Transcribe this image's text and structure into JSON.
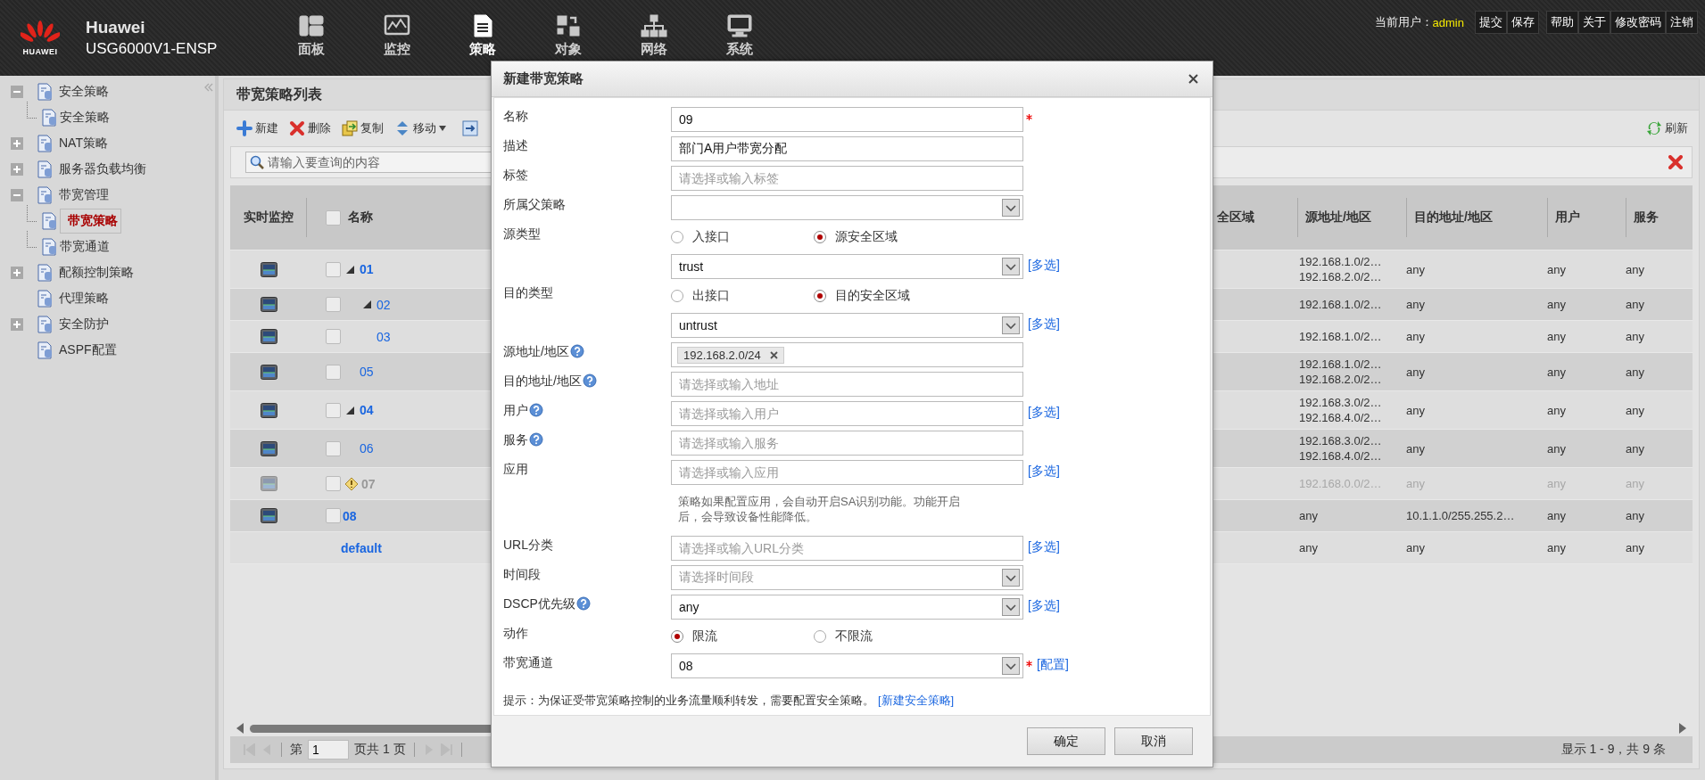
{
  "header": {
    "logo_text": "HUAWEI",
    "brand": "Huawei",
    "model": "USG6000V1-ENSP",
    "nav": [
      {
        "label": "面板",
        "selected": false
      },
      {
        "label": "监控",
        "selected": false
      },
      {
        "label": "策略",
        "selected": true
      },
      {
        "label": "对象",
        "selected": false
      },
      {
        "label": "网络",
        "selected": false
      },
      {
        "label": "系统",
        "selected": false
      }
    ],
    "user_label": "当前用户：",
    "user": "admin",
    "link_groups": [
      [
        "提交",
        "保存"
      ],
      [
        "帮助",
        "关于",
        "修改密码",
        "注销"
      ]
    ]
  },
  "sidebar": {
    "items": [
      {
        "label": "安全策略",
        "kind": "group",
        "expanded": true,
        "selected": false,
        "children": [
          {
            "label": "安全策略",
            "selected": false
          }
        ]
      },
      {
        "label": "NAT策略",
        "kind": "group",
        "expanded": false,
        "selected": false
      },
      {
        "label": "服务器负载均衡",
        "kind": "group",
        "expanded": false,
        "selected": false
      },
      {
        "label": "带宽管理",
        "kind": "group",
        "expanded": true,
        "selected": false,
        "children": [
          {
            "label": "带宽策略",
            "selected": true
          },
          {
            "label": "带宽通道",
            "selected": false
          }
        ]
      },
      {
        "label": "配额控制策略",
        "kind": "group",
        "expanded": false,
        "selected": false
      },
      {
        "label": "代理策略",
        "kind": "leaf",
        "selected": false
      },
      {
        "label": "安全防护",
        "kind": "group",
        "expanded": false,
        "selected": false
      },
      {
        "label": "ASPF配置",
        "kind": "leaf",
        "selected": false
      }
    ]
  },
  "panel": {
    "title": "带宽策略列表",
    "toolbar": [
      {
        "label": "新建",
        "menu": false
      },
      {
        "label": "删除",
        "menu": false
      },
      {
        "label": "复制",
        "menu": false
      },
      {
        "label": "移动",
        "menu": true
      }
    ],
    "refresh": "刷新",
    "search": {
      "placeholder": "请输入要查询的内容"
    }
  },
  "table": {
    "select_all": {
      "checked": false
    },
    "columns": [
      "实时监控",
      "名称",
      "全区域",
      "源地址/地区",
      "目的地址/地区",
      "用户",
      "服务"
    ],
    "rows": [
      {
        "kind": "policy",
        "name": "01",
        "bold": true,
        "disabled": false,
        "checked": false,
        "expanded": true,
        "src": [
          "192.168.1.0/2…",
          "192.168.2.0/2…"
        ],
        "dst": "any",
        "user": "any",
        "service": "any",
        "children": [
          {
            "kind": "policy",
            "name": "02",
            "bold": false,
            "disabled": false,
            "checked": false,
            "expanded": true,
            "src": [
              "192.168.1.0/2…"
            ],
            "dst": "any",
            "user": "any",
            "service": "any",
            "children": [
              {
                "kind": "policy",
                "name": "03",
                "bold": false,
                "disabled": false,
                "checked": false,
                "src": [
                  "192.168.1.0/2…"
                ],
                "dst": "any",
                "user": "any",
                "service": "any"
              }
            ]
          },
          {
            "kind": "policy",
            "name": "05",
            "bold": false,
            "disabled": false,
            "checked": false,
            "src": [
              "192.168.1.0/2…",
              "192.168.2.0/2…"
            ],
            "dst": "any",
            "user": "any",
            "service": "any"
          }
        ]
      },
      {
        "kind": "policy",
        "name": "04",
        "bold": true,
        "disabled": false,
        "checked": false,
        "expanded": true,
        "src": [
          "192.168.3.0/2…",
          "192.168.4.0/2…"
        ],
        "dst": "any",
        "user": "any",
        "service": "any",
        "children": [
          {
            "kind": "policy",
            "name": "06",
            "bold": false,
            "disabled": false,
            "checked": false,
            "src": [
              "192.168.3.0/2…",
              "192.168.4.0/2…"
            ],
            "dst": "any",
            "user": "any",
            "service": "any"
          }
        ]
      },
      {
        "kind": "policy",
        "name": "07",
        "bold": true,
        "disabled": true,
        "checked": false,
        "src": [
          "192.168.0.0/2…"
        ],
        "dst": "any",
        "user": "any",
        "service": "any"
      },
      {
        "kind": "policy",
        "name": "08",
        "bold": true,
        "disabled": false,
        "checked": false,
        "src": [
          "any"
        ],
        "dst": "10.1.1.0/255.255.2…",
        "user": "any",
        "service": "any"
      },
      {
        "kind": "default",
        "name": "default",
        "bold": true,
        "src": [
          "any"
        ],
        "dst": "any",
        "user": "any",
        "service": "any"
      }
    ]
  },
  "pagination": {
    "page_prefix": "第",
    "page": "1",
    "page_suffix": "页共 1 页",
    "info": "显示 1 - 9，共 9 条"
  },
  "dialog": {
    "title": "新建带宽策略",
    "fields": [
      {
        "kind": "input",
        "label": "名称",
        "value": "09",
        "required": true
      },
      {
        "kind": "input",
        "label": "描述",
        "value": "部门A用户带宽分配"
      },
      {
        "kind": "input",
        "label": "标签",
        "placeholder": "请选择或输入标签"
      },
      {
        "kind": "select",
        "label": "所属父策略"
      },
      {
        "kind": "radio",
        "label": "源类型",
        "options": [
          {
            "label": "入接口",
            "selected": false
          },
          {
            "label": "源安全区域",
            "selected": true
          }
        ]
      },
      {
        "kind": "select",
        "value": "trust",
        "link": "[多选]"
      },
      {
        "kind": "radio",
        "label": "目的类型",
        "options": [
          {
            "label": "出接口",
            "selected": false
          },
          {
            "label": "目的安全区域",
            "selected": true
          }
        ]
      },
      {
        "kind": "select",
        "value": "untrust",
        "link": "[多选]"
      },
      {
        "kind": "tags",
        "label": "源地址/地区",
        "help": true,
        "tags": [
          "192.168.2.0/24"
        ]
      },
      {
        "kind": "input",
        "label": "目的地址/地区",
        "help": true,
        "placeholder": "请选择或输入地址"
      },
      {
        "kind": "input",
        "label": "用户",
        "help": true,
        "placeholder": "请选择或输入用户",
        "link": "[多选]"
      },
      {
        "kind": "input",
        "label": "服务",
        "help": true,
        "placeholder": "请选择或输入服务"
      },
      {
        "kind": "input",
        "label": "应用",
        "placeholder": "请选择或输入应用",
        "link": "[多选]",
        "note": "策略如果配置应用，会自动开启SA识别功能。功能开启后，会导致设备性能降低。"
      },
      {
        "kind": "input",
        "label": "URL分类",
        "placeholder": "请选择或输入URL分类",
        "link": "[多选]"
      },
      {
        "kind": "select",
        "label": "时间段",
        "placeholder": "请选择时间段"
      },
      {
        "kind": "select",
        "label": "DSCP优先级",
        "help": true,
        "value": "any",
        "link": "[多选]"
      },
      {
        "kind": "radio",
        "label": "动作",
        "options": [
          {
            "label": "限流",
            "selected": true
          },
          {
            "label": "不限流",
            "selected": false
          }
        ]
      },
      {
        "kind": "select",
        "label": "带宽通道",
        "value": "08",
        "required": true,
        "link": "[配置]"
      }
    ],
    "hint": "提示：为保证受带宽策略控制的业务流量顺利转发，需要配置安全策略。",
    "hint_link": "[新建安全策略]",
    "buttons": [
      "确定",
      "取消"
    ]
  }
}
